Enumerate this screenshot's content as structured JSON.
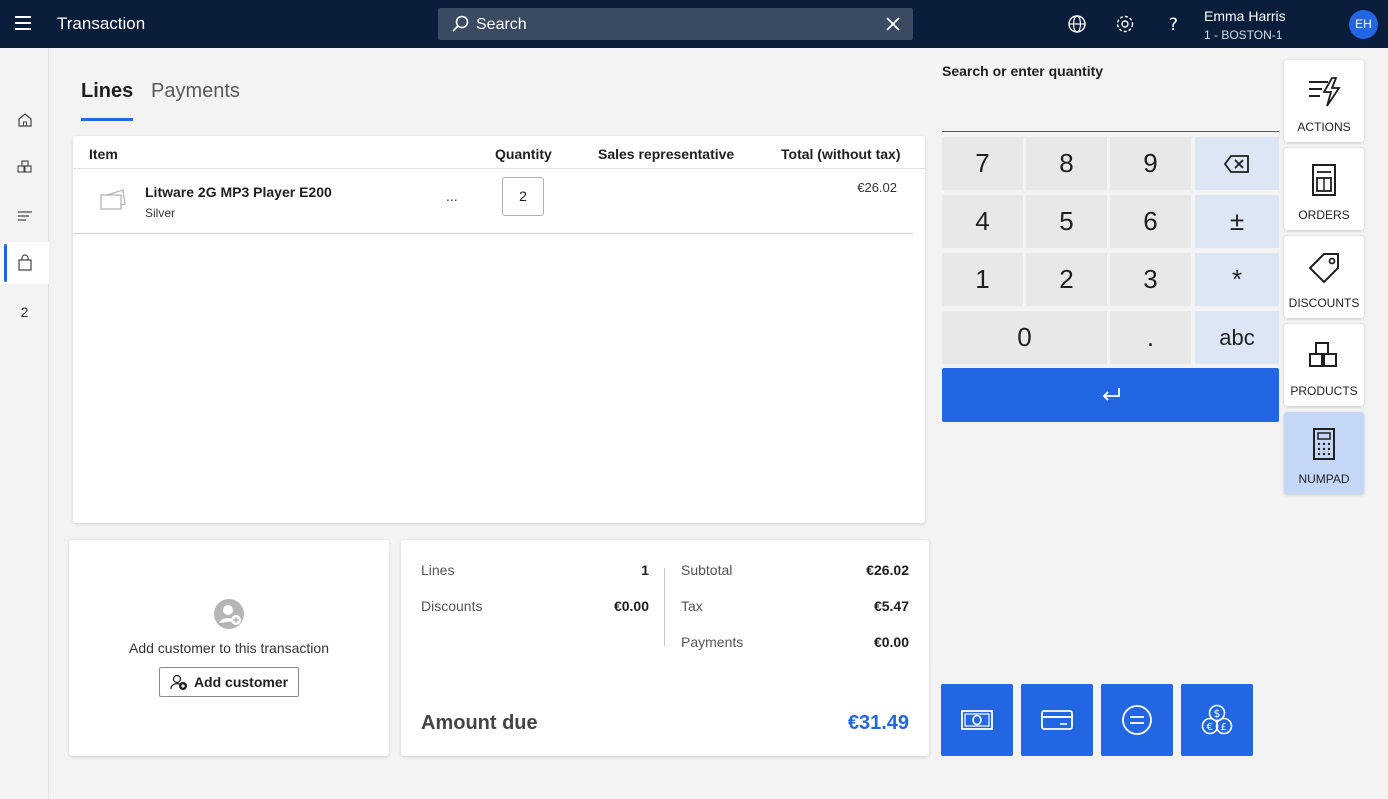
{
  "header": {
    "title": "Transaction",
    "search_label": "Search",
    "user_name": "Emma Harris",
    "user_store": "1 - BOSTON-1",
    "user_initials": "EH"
  },
  "rail": {
    "badge_count": "2"
  },
  "tabs": [
    {
      "label": "Lines"
    },
    {
      "label": "Payments"
    }
  ],
  "lines_table": {
    "columns": [
      "Item",
      "Quantity",
      "Sales representative",
      "Total (without tax)"
    ],
    "rows": [
      {
        "name": "Litware 2G MP3 Player E200",
        "variant": "Silver",
        "more": "...",
        "quantity": "2",
        "sales_rep": "",
        "total": "€26.02"
      }
    ]
  },
  "customer": {
    "prompt": "Add customer to this transaction",
    "button_label": "Add customer"
  },
  "totals": {
    "lines_label": "Lines",
    "lines_value": "1",
    "discounts_label": "Discounts",
    "discounts_value": "€0.00",
    "subtotal_label": "Subtotal",
    "subtotal_value": "€26.02",
    "tax_label": "Tax",
    "tax_value": "€5.47",
    "payments_label": "Payments",
    "payments_value": "€0.00",
    "amount_due_label": "Amount due",
    "amount_due_value": "€31.49"
  },
  "numpad": {
    "label": "Search or enter quantity",
    "keys": [
      "7",
      "8",
      "9",
      "4",
      "5",
      "6",
      "1",
      "2",
      "3",
      "0",
      ".",
      "±",
      "*",
      "abc"
    ]
  },
  "side_panel": [
    {
      "label": "ACTIONS",
      "icon": "lightning-list-icon"
    },
    {
      "label": "ORDERS",
      "icon": "orders-icon"
    },
    {
      "label": "DISCOUNTS",
      "icon": "tag-icon"
    },
    {
      "label": "PRODUCTS",
      "icon": "boxes-icon"
    },
    {
      "label": "NUMPAD",
      "icon": "calculator-icon"
    }
  ],
  "colors": {
    "header_bg": "#0a1d3b",
    "accent": "#2266e3",
    "active_panel": "#c5d7f6"
  }
}
